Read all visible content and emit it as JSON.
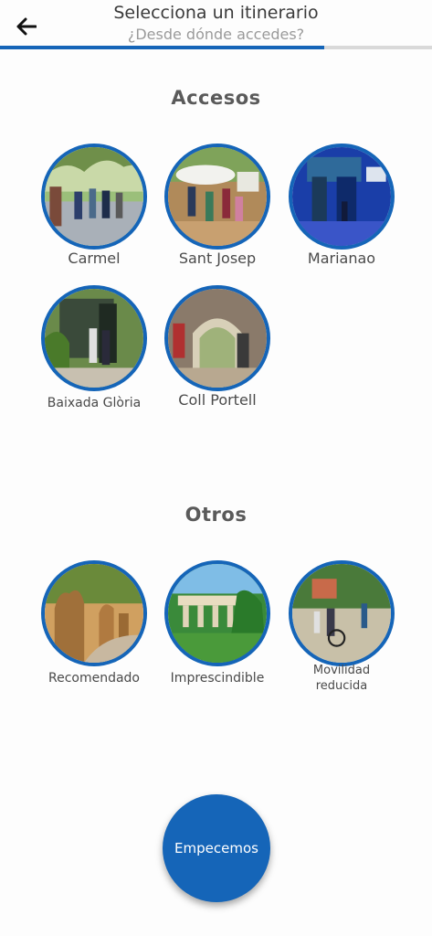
{
  "header": {
    "title": "Selecciona un itinerario",
    "subtitle": "¿Desde dónde accedes?",
    "progress": 0.75
  },
  "accesos": {
    "title": "Accesos",
    "items": [
      {
        "label": "Carmel",
        "icon": "photo"
      },
      {
        "label": "Sant Josep",
        "icon": "photo"
      },
      {
        "label": "Marianao",
        "icon": "photo"
      },
      {
        "label": "Baixada Glòria",
        "icon": "photo"
      },
      {
        "label": "Coll Portell",
        "icon": "photo"
      }
    ]
  },
  "otros": {
    "title": "Otros",
    "items": [
      {
        "label": "Recomendado",
        "icon": "photo"
      },
      {
        "label": "Imprescindible",
        "icon": "photo"
      },
      {
        "label": "Movilidad reducida",
        "line1": "Movilidad",
        "line2": "reducida",
        "icon": "photo"
      }
    ]
  },
  "start_button": {
    "label": "Empecemos"
  },
  "colors": {
    "accent": "#1565b8",
    "track": "#d9d9d9"
  }
}
